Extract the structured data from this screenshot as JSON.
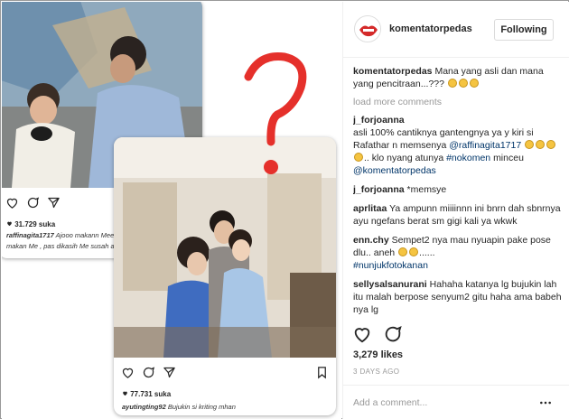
{
  "post": {
    "author": "komentatorpedas",
    "follow_label": "Following",
    "likes": "3,279 likes",
    "date": "3 DAYS AGO",
    "add_comment_placeholder": "Add a comment...",
    "load_more": "load more comments"
  },
  "caption": {
    "user": "komentatorpedas",
    "text": "Mana yang asli dan mana yang pencitraan...???"
  },
  "comments": [
    {
      "user": "j_forjoanna",
      "text_a": "asli 100% cantiknya gantengnya ya y kiri si Rafathar n memsenya",
      "mention1": "@raffinagita1717",
      "text_b": "..",
      "text_c": "klo nyang atunya",
      "tag": "#nokomen",
      "text_d": "minceu",
      "mention2": "@komentatorpedas"
    },
    {
      "user": "j_forjoanna",
      "text": "*memsye"
    },
    {
      "user": "aprlitaa",
      "text": "Ya ampunn miiiinnn ini bnrn dah sbnrnya ayu ngefans berat sm gigi kali ya wkwk"
    },
    {
      "user": "enn.chy",
      "text_a": "Sempet2 nya mau nyuapin pake pose dlu.. aneh",
      "text_b": "......",
      "tag": "#nunjukfotokanan"
    },
    {
      "user": "sellysalsanurani",
      "text": "Hahaha katanya lg bujukin lah itu malah berpose senyum2 gitu haha ama babeh nya lg"
    }
  ],
  "embedded": {
    "card1_likes": "31.729 suka",
    "card1_user": "raffinagita1717",
    "card1_caption": "Ajooo makann Meeeee . Rafathar mau makan Me , pas dikasih Me susah amaattt",
    "card2_likes": "77.731 suka",
    "card2_user": "ayutingting92",
    "card2_caption": "Bujukin si kriting mhan"
  },
  "colors": {
    "question_mark": "#e5302b",
    "link": "#003569",
    "muted": "#999999"
  },
  "icons": [
    "heart-icon",
    "comment-icon",
    "share-icon",
    "bookmark-icon",
    "more-icon"
  ]
}
